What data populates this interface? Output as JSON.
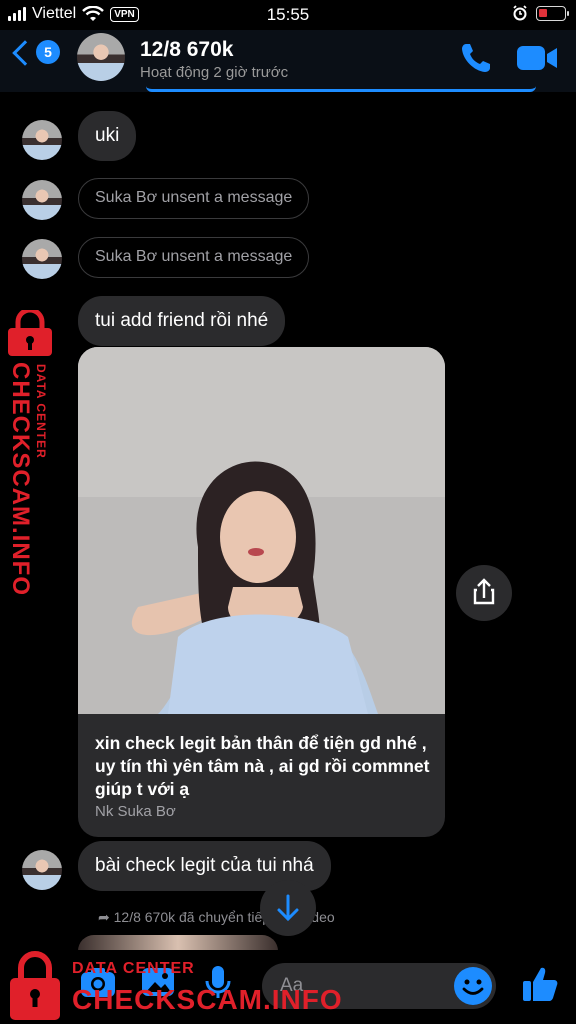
{
  "status_bar": {
    "carrier": "Viettel",
    "vpn": "VPN",
    "time": "15:55"
  },
  "header": {
    "unread_count": "5",
    "title": "12/8 670k",
    "subtitle": "Hoạt động 2 giờ trước",
    "accent": "#1d8cff"
  },
  "messages": {
    "m1": "uki",
    "unsent1": "Suka Bơ unsent a message",
    "unsent2": "Suka Bơ unsent a message",
    "m2": "tui add friend rồi nhé",
    "card_text": "xin check legit bản thân để tiện gd nhé , uy tín thì yên tâm nà , ai gd rồi commnet giúp t với ạ",
    "card_author": "Nk Suka Bơ",
    "m3": "bài check legit của tui nhá",
    "forward_info": "12/8 670k đã chuyển tiếp một video"
  },
  "composer": {
    "placeholder": "Aa"
  },
  "watermark": {
    "side_big": "CHECKSCAM.INFO",
    "side_small": "DATA CENTER",
    "bottom_small": "DATA CENTER",
    "bottom_big": "CHECKSCAM.INFO",
    "color": "#e0202a"
  },
  "icons": [
    "back-chevron-icon",
    "phone-icon",
    "video-camera-icon",
    "share-icon",
    "arrow-down-icon",
    "camera-icon",
    "image-icon",
    "microphone-icon",
    "emoji-icon",
    "thumbs-up-icon",
    "lock-icon",
    "alarm-icon",
    "wifi-icon",
    "battery-icon"
  ]
}
